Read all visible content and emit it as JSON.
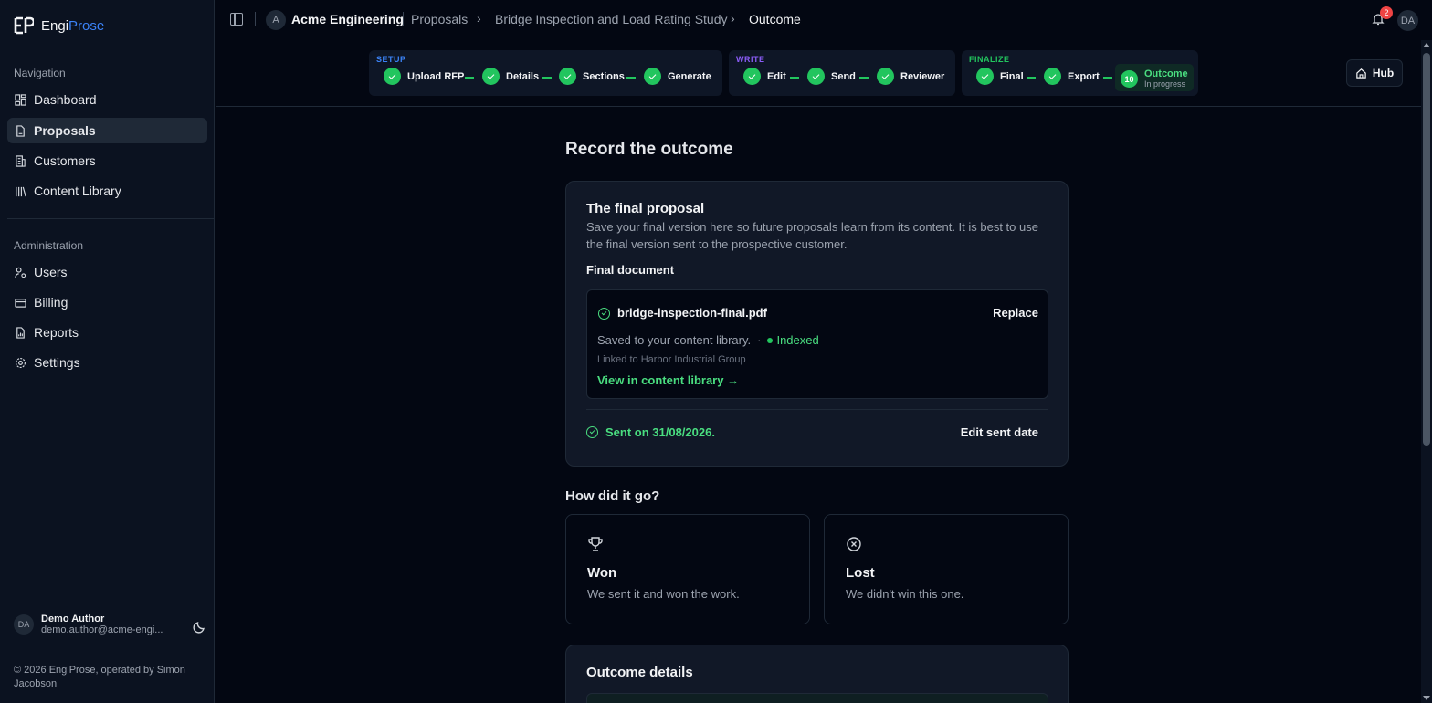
{
  "app": {
    "name_part1": "Engi",
    "name_part2": "Prose",
    "brand_color": "#3b82f6",
    "accent_color": "#22c55e"
  },
  "sidebar": {
    "nav_label": "Navigation",
    "nav_items": [
      {
        "label": "Dashboard",
        "icon": "dashboard-icon",
        "active": false
      },
      {
        "label": "Proposals",
        "icon": "document-icon",
        "active": true
      },
      {
        "label": "Customers",
        "icon": "building-icon",
        "active": false
      },
      {
        "label": "Content Library",
        "icon": "library-icon",
        "active": false
      }
    ],
    "admin_label": "Administration",
    "admin_items": [
      {
        "label": "Users",
        "icon": "users-cog-icon"
      },
      {
        "label": "Billing",
        "icon": "credit-card-icon"
      },
      {
        "label": "Reports",
        "icon": "report-icon"
      },
      {
        "label": "Settings",
        "icon": "gear-icon"
      }
    ],
    "user": {
      "initials": "DA",
      "name": "Demo Author",
      "email": "demo.author@acme-engi..."
    },
    "footer": "© 2026 EngiProse, operated by Simon Jacobson"
  },
  "topbar": {
    "org_initial": "A",
    "org_name": "Acme Engineering",
    "breadcrumbs": [
      "Proposals",
      "Bridge Inspection and Load Rating Study",
      "Outcome"
    ],
    "notification_count": "2",
    "user_initials": "DA"
  },
  "stepper": {
    "groups": [
      {
        "label": "SETUP",
        "color": "#3b82f6",
        "steps": [
          "Upload RFP",
          "Details",
          "Sections",
          "Generate"
        ]
      },
      {
        "label": "WRITE",
        "color": "#8b5cf6",
        "steps": [
          "Edit",
          "Send",
          "Reviewer"
        ]
      },
      {
        "label": "FINALIZE",
        "color": "#22c55e",
        "steps": [
          "Final",
          "Export"
        ]
      }
    ],
    "current": {
      "number": "10",
      "label": "Outcome",
      "status": "In progress"
    },
    "hub_label": "Hub"
  },
  "main": {
    "title": "Record the outcome",
    "final_card": {
      "title": "The final proposal",
      "description": "Save your final version here so future proposals learn from its content. It is best to use the final version sent to the prospective customer.",
      "doc_label": "Final document",
      "file_name": "bridge-inspection-final.pdf",
      "replace_label": "Replace",
      "saved_text": "Saved to your content library.",
      "separator": "·",
      "indexed_label": "Indexed",
      "linked_text": "Linked to Harbor Industrial Group",
      "view_link": "View in content library →",
      "sent_text": "Sent on 31/08/2026.",
      "edit_sent_label": "Edit sent date"
    },
    "how_heading": "How did it go?",
    "choices": [
      {
        "title": "Won",
        "description": "We sent it and won the work.",
        "icon": "trophy-icon"
      },
      {
        "title": "Lost",
        "description": "We didn't win this one.",
        "icon": "x-circle-icon"
      }
    ],
    "outcome_details_title": "Outcome details"
  }
}
